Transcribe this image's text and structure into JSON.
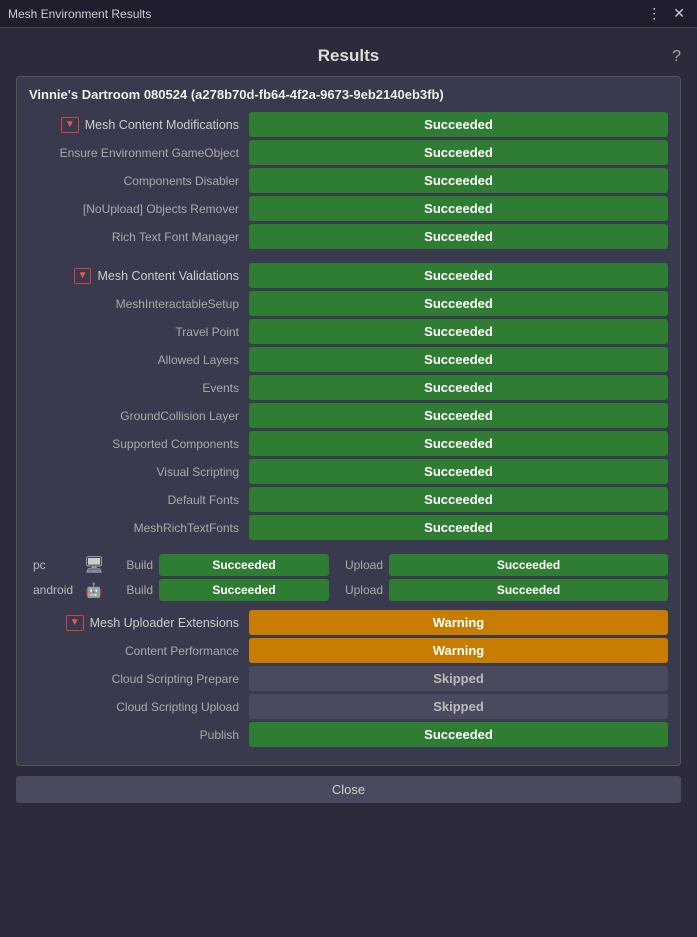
{
  "titleBar": {
    "title": "Mesh Environment Results",
    "menuIcon": "⋮",
    "closeIcon": "✕"
  },
  "header": {
    "title": "Results",
    "helpIcon": "?"
  },
  "envCard": {
    "title": "Vinnie's Dartroom 080524 (a278b70d-fb64-4f2a-9673-9eb2140eb3fb)"
  },
  "sections": [
    {
      "id": "content-modifications",
      "label": "Mesh Content Modifications",
      "status": "Succeeded",
      "statusType": "succeeded",
      "rows": [
        {
          "label": "Ensure Environment GameObject",
          "status": "Succeeded",
          "statusType": "succeeded"
        },
        {
          "label": "Components Disabler",
          "status": "Succeeded",
          "statusType": "succeeded"
        },
        {
          "label": "[NoUpload] Objects Remover",
          "status": "Succeeded",
          "statusType": "succeeded"
        },
        {
          "label": "Rich Text Font Manager",
          "status": "Succeeded",
          "statusType": "succeeded"
        }
      ]
    },
    {
      "id": "content-validations",
      "label": "Mesh Content Validations",
      "status": "Succeeded",
      "statusType": "succeeded",
      "rows": [
        {
          "label": "MeshInteractableSetup",
          "status": "Succeeded",
          "statusType": "succeeded"
        },
        {
          "label": "Travel Point",
          "status": "Succeeded",
          "statusType": "succeeded"
        },
        {
          "label": "Allowed Layers",
          "status": "Succeeded",
          "statusType": "succeeded"
        },
        {
          "label": "Events",
          "status": "Succeeded",
          "statusType": "succeeded"
        },
        {
          "label": "GroundCollision Layer",
          "status": "Succeeded",
          "statusType": "succeeded"
        },
        {
          "label": "Supported Components",
          "status": "Succeeded",
          "statusType": "succeeded"
        },
        {
          "label": "Visual Scripting",
          "status": "Succeeded",
          "statusType": "succeeded"
        },
        {
          "label": "Default Fonts",
          "status": "Succeeded",
          "statusType": "succeeded"
        },
        {
          "label": "MeshRichTextFonts",
          "status": "Succeeded",
          "statusType": "succeeded"
        }
      ]
    }
  ],
  "platforms": [
    {
      "name": "pc",
      "icon": "🖥",
      "build": {
        "status": "Succeeded",
        "statusType": "succeeded"
      },
      "upload": {
        "status": "Succeeded",
        "statusType": "succeeded"
      }
    },
    {
      "name": "android",
      "icon": "🤖",
      "build": {
        "status": "Succeeded",
        "statusType": "succeeded"
      },
      "upload": {
        "status": "Succeeded",
        "statusType": "succeeded"
      }
    }
  ],
  "uploaderExtensions": {
    "label": "Mesh Uploader Extensions",
    "status": "Warning",
    "statusType": "warning",
    "rows": [
      {
        "label": "Content Performance",
        "status": "Warning",
        "statusType": "warning"
      },
      {
        "label": "Cloud Scripting Prepare",
        "status": "Skipped",
        "statusType": "skipped"
      },
      {
        "label": "Cloud Scripting Upload",
        "status": "Skipped",
        "statusType": "skipped"
      },
      {
        "label": "Publish",
        "status": "Succeeded",
        "statusType": "succeeded"
      }
    ]
  },
  "closeButton": "Close"
}
